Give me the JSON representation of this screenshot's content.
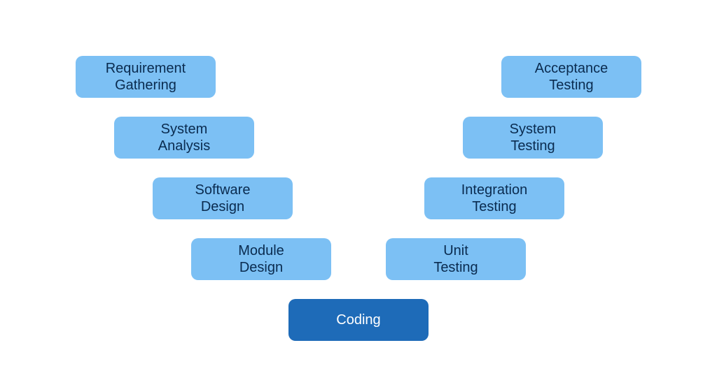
{
  "diagram": {
    "type": "v-model",
    "colors": {
      "light_bg": "#7cc0f4",
      "light_text": "#0a2b4f",
      "dark_bg": "#1e6bb8",
      "dark_text": "#ffffff"
    },
    "left": [
      {
        "label": "Requirement\nGathering"
      },
      {
        "label": "System\nAnalysis"
      },
      {
        "label": "Software\nDesign"
      },
      {
        "label": "Module\nDesign"
      }
    ],
    "bottom": {
      "label": "Coding"
    },
    "right": [
      {
        "label": "Acceptance\nTesting"
      },
      {
        "label": "System\nTesting"
      },
      {
        "label": "Integration\nTesting"
      },
      {
        "label": "Unit\nTesting"
      }
    ]
  }
}
